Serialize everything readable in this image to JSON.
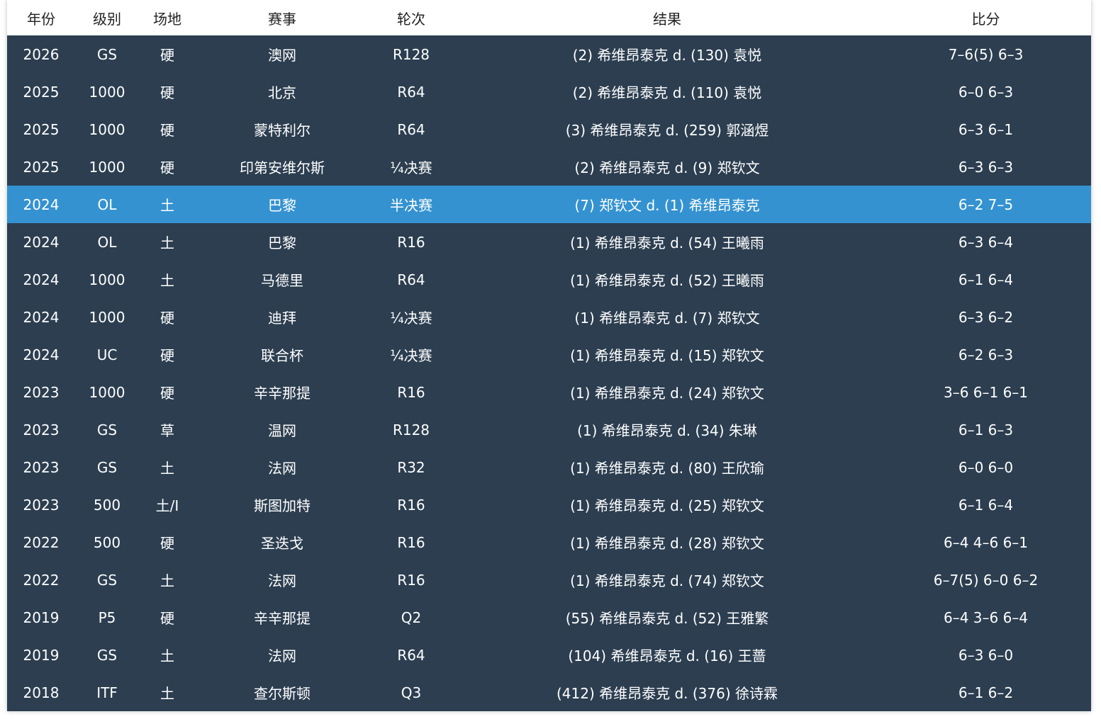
{
  "headers": {
    "year": "年份",
    "level": "级别",
    "surface": "场地",
    "event": "赛事",
    "round": "轮次",
    "result": "结果",
    "score": "比分"
  },
  "colors": {
    "row_bg": "#2c3e50",
    "highlight_bg": "#3492d1",
    "header_bg": "#ffffff"
  },
  "highlighted_row": 4,
  "rows": [
    {
      "year": "2026",
      "level": "GS",
      "surface": "硬",
      "event": "澳网",
      "round": "R128",
      "result": "(2) 希维昂泰克 d. (130) 袁悦",
      "score": "7–6(5) 6–3"
    },
    {
      "year": "2025",
      "level": "1000",
      "surface": "硬",
      "event": "北京",
      "round": "R64",
      "result": "(2) 希维昂泰克 d. (110) 袁悦",
      "score": "6–0 6–3"
    },
    {
      "year": "2025",
      "level": "1000",
      "surface": "硬",
      "event": "蒙特利尔",
      "round": "R64",
      "result": "(3) 希维昂泰克 d. (259) 郭涵煜",
      "score": "6–3 6–1"
    },
    {
      "year": "2025",
      "level": "1000",
      "surface": "硬",
      "event": "印第安维尔斯",
      "round": "¼决赛",
      "result": "(2) 希维昂泰克 d. (9) 郑钦文",
      "score": "6–3 6–3"
    },
    {
      "year": "2024",
      "level": "OL",
      "surface": "土",
      "event": "巴黎",
      "round": "半决赛",
      "result": "(7) 郑钦文 d. (1) 希维昂泰克",
      "score": "6–2 7–5"
    },
    {
      "year": "2024",
      "level": "OL",
      "surface": "土",
      "event": "巴黎",
      "round": "R16",
      "result": "(1) 希维昂泰克 d. (54) 王曦雨",
      "score": "6–3 6–4"
    },
    {
      "year": "2024",
      "level": "1000",
      "surface": "土",
      "event": "马德里",
      "round": "R64",
      "result": "(1) 希维昂泰克 d. (52) 王曦雨",
      "score": "6–1 6–4"
    },
    {
      "year": "2024",
      "level": "1000",
      "surface": "硬",
      "event": "迪拜",
      "round": "¼决赛",
      "result": "(1) 希维昂泰克 d. (7) 郑钦文",
      "score": "6–3 6–2"
    },
    {
      "year": "2024",
      "level": "UC",
      "surface": "硬",
      "event": "联合杯",
      "round": "¼决赛",
      "result": "(1) 希维昂泰克 d. (15) 郑钦文",
      "score": "6–2 6–3"
    },
    {
      "year": "2023",
      "level": "1000",
      "surface": "硬",
      "event": "辛辛那提",
      "round": "R16",
      "result": "(1) 希维昂泰克 d. (24) 郑钦文",
      "score": "3–6 6–1 6–1"
    },
    {
      "year": "2023",
      "level": "GS",
      "surface": "草",
      "event": "温网",
      "round": "R128",
      "result": "(1) 希维昂泰克 d. (34) 朱琳",
      "score": "6–1 6–3"
    },
    {
      "year": "2023",
      "level": "GS",
      "surface": "土",
      "event": "法网",
      "round": "R32",
      "result": "(1) 希维昂泰克 d. (80) 王欣瑜",
      "score": "6–0 6–0"
    },
    {
      "year": "2023",
      "level": "500",
      "surface": "土/I",
      "event": "斯图加特",
      "round": "R16",
      "result": "(1) 希维昂泰克 d. (25) 郑钦文",
      "score": "6–1 6–4"
    },
    {
      "year": "2022",
      "level": "500",
      "surface": "硬",
      "event": "圣迭戈",
      "round": "R16",
      "result": "(1) 希维昂泰克 d. (28) 郑钦文",
      "score": "6–4 4–6 6–1"
    },
    {
      "year": "2022",
      "level": "GS",
      "surface": "土",
      "event": "法网",
      "round": "R16",
      "result": "(1) 希维昂泰克 d. (74) 郑钦文",
      "score": "6–7(5) 6–0 6–2"
    },
    {
      "year": "2019",
      "level": "P5",
      "surface": "硬",
      "event": "辛辛那提",
      "round": "Q2",
      "result": "(55) 希维昂泰克 d. (52) 王雅繁",
      "score": "6–4 3–6 6–4"
    },
    {
      "year": "2019",
      "level": "GS",
      "surface": "土",
      "event": "法网",
      "round": "R64",
      "result": "(104) 希维昂泰克 d. (16) 王蔷",
      "score": "6–3 6–0"
    },
    {
      "year": "2018",
      "level": "ITF",
      "surface": "土",
      "event": "查尔斯顿",
      "round": "Q3",
      "result": "(412) 希维昂泰克 d. (376) 徐诗霖",
      "score": "6–1 6–2"
    }
  ]
}
